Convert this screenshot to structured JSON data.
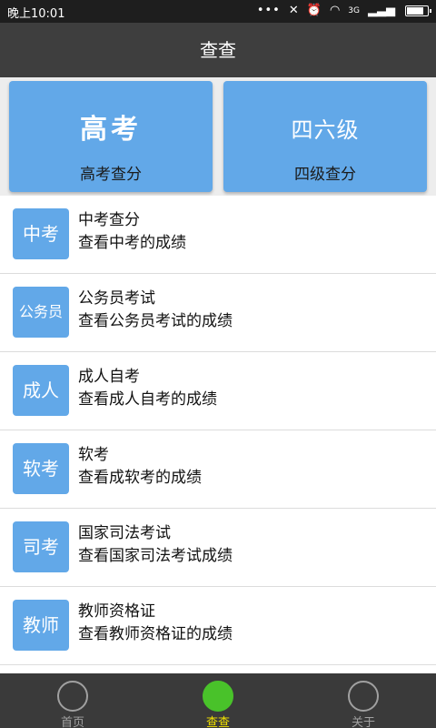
{
  "status_bar": {
    "time": "晚上10:01",
    "network": "3G",
    "icons": [
      "dots-icon",
      "mute-icon",
      "alarm-icon",
      "wifi-icon",
      "signal-icon",
      "battery-icon"
    ]
  },
  "header": {
    "title": "查查"
  },
  "top_cards": [
    {
      "logo": "高考",
      "label": "高考查分"
    },
    {
      "logo": "四六级",
      "label": "四级查分"
    }
  ],
  "list": [
    {
      "icon_text": "中考",
      "title": "中考查分",
      "subtitle": "查看中考的成绩"
    },
    {
      "icon_text": "公务员",
      "title": "公务员考试",
      "subtitle": "查看公务员考试的成绩"
    },
    {
      "icon_text": "成人",
      "title": "成人自考",
      "subtitle": "查看成人自考的成绩"
    },
    {
      "icon_text": "软考",
      "title": "软考",
      "subtitle": "查看成软考的成绩"
    },
    {
      "icon_text": "司考",
      "title": "国家司法考试",
      "subtitle": "查看国家司法考试成绩"
    },
    {
      "icon_text": "教师",
      "title": "教师资格证",
      "subtitle": "查看教师资格证的成绩"
    }
  ],
  "bottom_nav": [
    {
      "label": "首页",
      "active": false
    },
    {
      "label": "查查",
      "active": true
    },
    {
      "label": "关于",
      "active": false
    }
  ],
  "colors": {
    "accent_blue": "#62a8e8",
    "active_green": "#49c22a",
    "active_label": "#f0e000",
    "title_bar": "#3e3e3e"
  }
}
